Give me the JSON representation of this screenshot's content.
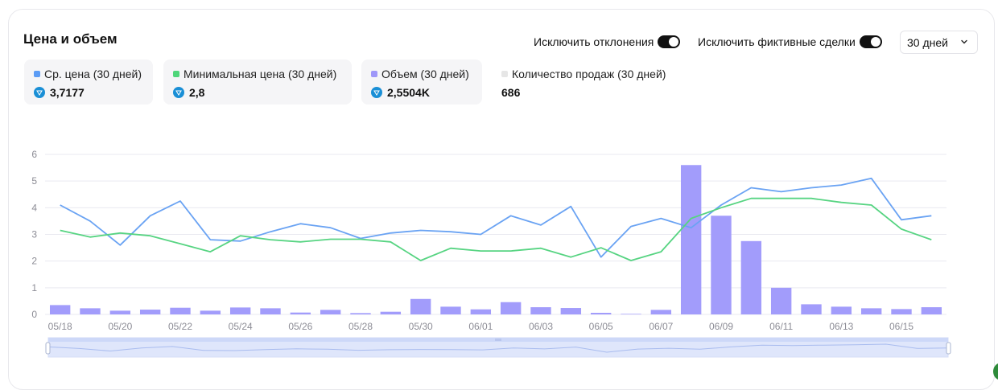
{
  "title": "Цена и объем",
  "toggles": {
    "exclude_outliers": {
      "label": "Исключить отклонения",
      "on": true
    },
    "exclude_fake": {
      "label": "Исключить фиктивные сделки",
      "on": true
    }
  },
  "period_select": {
    "value": "30 дней"
  },
  "stats": [
    {
      "label": "Ср. цена (30 дней)",
      "value": "3,7177",
      "color": "#5b9cf5",
      "currency_icon": "ton-icon"
    },
    {
      "label": "Минимальная цена (30 дней)",
      "value": "2,8",
      "color": "#4fd67a",
      "currency_icon": "ton-icon"
    },
    {
      "label": "Объем (30 дней)",
      "value": "2,5504K",
      "color": "#9e97f9",
      "currency_icon": "ton-icon"
    },
    {
      "label": "Количество продаж (30 дней)",
      "value": "686",
      "color": "#e6e6e6"
    }
  ],
  "chart_data": {
    "type": "bar",
    "categories": [
      "05/18",
      "05/19",
      "05/20",
      "05/21",
      "05/22",
      "05/23",
      "05/24",
      "05/25",
      "05/26",
      "05/27",
      "05/28",
      "05/29",
      "05/30",
      "05/31",
      "06/01",
      "06/02",
      "06/03",
      "06/04",
      "06/05",
      "06/06",
      "06/07",
      "06/08",
      "06/09",
      "06/10",
      "06/11",
      "06/12",
      "06/13",
      "06/14",
      "06/15",
      "06/16"
    ],
    "x_tick_labels": [
      "05/18",
      "05/20",
      "05/22",
      "05/24",
      "05/26",
      "05/28",
      "05/30",
      "06/01",
      "06/03",
      "06/05",
      "06/07",
      "06/09",
      "06/11",
      "06/13",
      "06/15"
    ],
    "ylim": [
      0,
      6
    ],
    "yticks": [
      "0",
      "1",
      "2",
      "3",
      "4",
      "5",
      "6"
    ],
    "grid": true,
    "series": [
      {
        "type": "bar",
        "color": "#a29cfb",
        "values": [
          0.35,
          0.23,
          0.14,
          0.18,
          0.25,
          0.14,
          0.26,
          0.23,
          0.07,
          0.17,
          0.05,
          0.1,
          0.58,
          0.29,
          0.19,
          0.46,
          0.27,
          0.24,
          0.06,
          0.02,
          0.17,
          5.6,
          3.7,
          2.75,
          1.0,
          0.38,
          0.29,
          0.23,
          0.2,
          0.27
        ]
      },
      {
        "type": "line",
        "color": "#6aa3f3",
        "values": [
          4.1,
          3.5,
          2.6,
          3.7,
          4.25,
          2.8,
          2.75,
          3.1,
          3.4,
          3.25,
          2.85,
          3.05,
          3.15,
          3.1,
          3.0,
          3.7,
          3.35,
          4.05,
          2.15,
          3.3,
          3.6,
          3.25,
          4.1,
          4.75,
          4.6,
          4.75,
          4.85,
          5.1,
          3.55,
          3.7
        ]
      },
      {
        "type": "line",
        "color": "#57d482",
        "values": [
          3.15,
          2.9,
          3.05,
          2.95,
          2.65,
          2.35,
          2.95,
          2.8,
          2.72,
          2.82,
          2.82,
          2.72,
          2.02,
          2.48,
          2.38,
          2.38,
          2.48,
          2.15,
          2.5,
          2.02,
          2.35,
          3.6,
          4.0,
          4.35,
          4.35,
          4.35,
          4.2,
          4.1,
          3.2,
          2.8
        ]
      }
    ]
  }
}
